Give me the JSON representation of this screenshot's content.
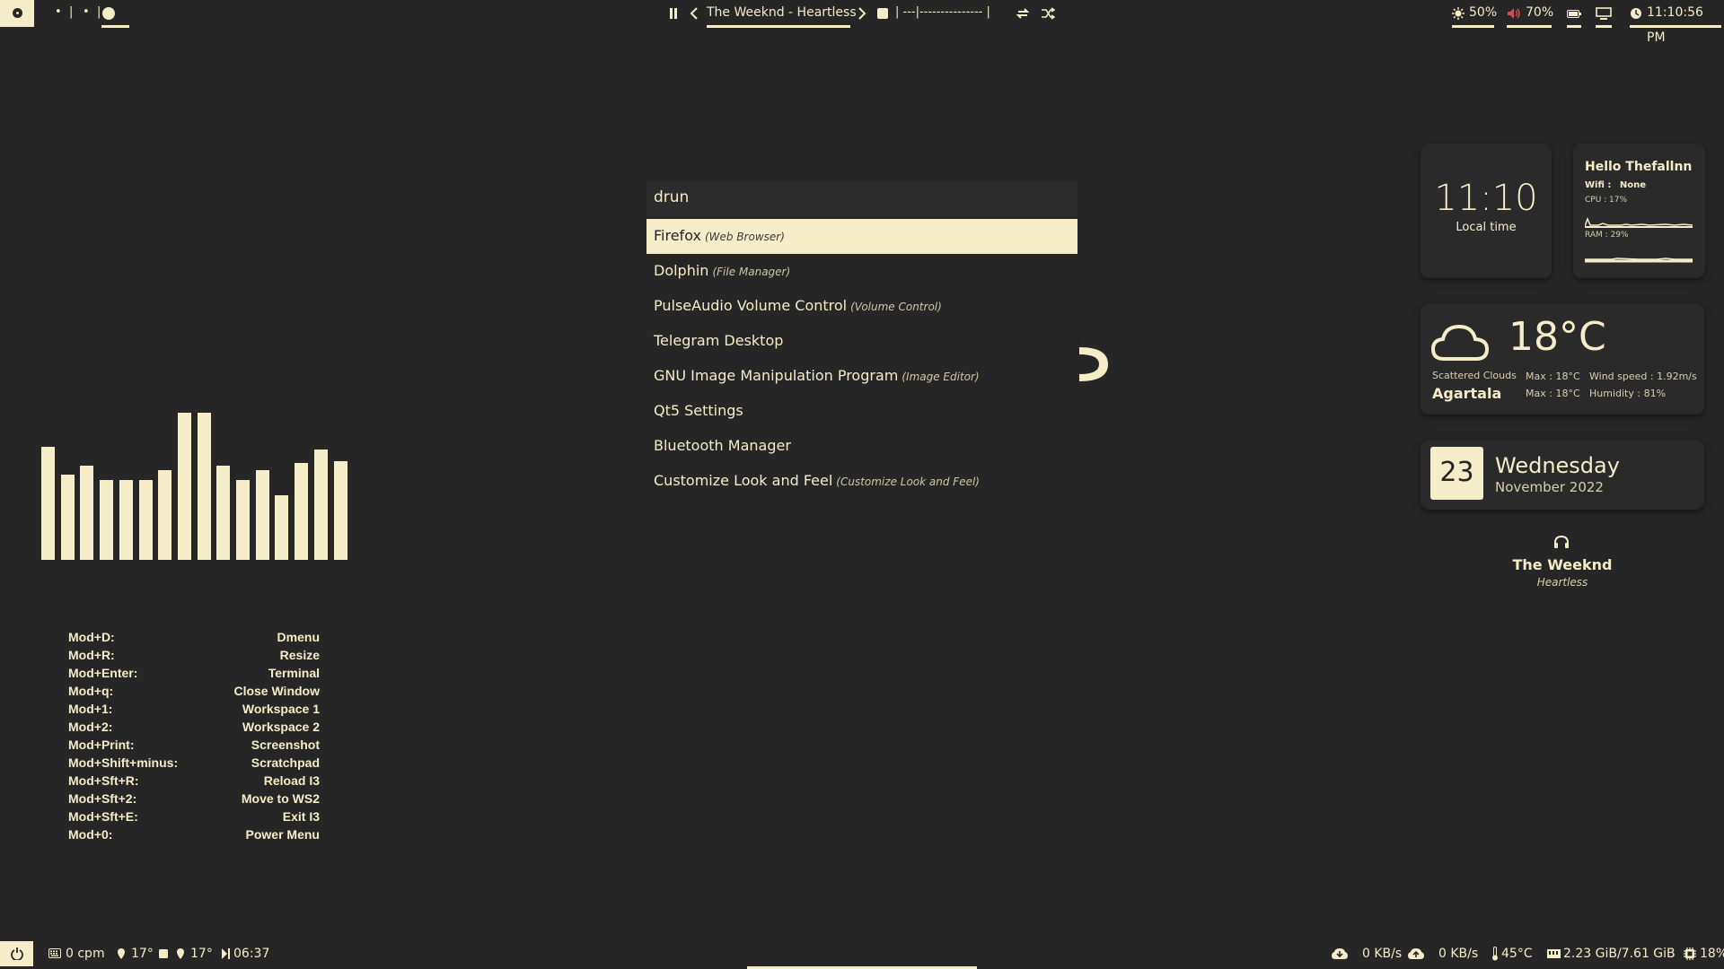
{
  "colors": {
    "background": "#262626",
    "accent": "#f5ecc8",
    "volume_icon": "#e04848"
  },
  "topbar": {
    "workspaces": [
      "•",
      "|",
      "•",
      "|"
    ],
    "media": {
      "icons": [
        "pause-icon",
        "prev-icon",
        "next-icon",
        "stop-icon",
        "repeat-icon",
        "shuffle-icon"
      ],
      "track": "The Weeknd - Heartless",
      "progress_text": "| ---|--------------- |"
    },
    "tray": {
      "brightness": "50%",
      "volume": "70%",
      "clock": "11:10:56 PM"
    }
  },
  "launcher": {
    "mode": "drun",
    "entries": [
      {
        "name": "Firefox",
        "desc": "(Web Browser)"
      },
      {
        "name": "Dolphin",
        "desc": "(File Manager)"
      },
      {
        "name": "PulseAudio Volume Control",
        "desc": "(Volume Control)"
      },
      {
        "name": "Telegram Desktop",
        "desc": ""
      },
      {
        "name": "GNU Image Manipulation Program",
        "desc": "(Image Editor)"
      },
      {
        "name": "Qt5 Settings",
        "desc": ""
      },
      {
        "name": "Bluetooth Manager",
        "desc": ""
      },
      {
        "name": "Customize Look and Feel",
        "desc": "(Customize Look and Feel)"
      }
    ],
    "selected_index": 0
  },
  "visualizer": {
    "levels": [
      0.77,
      0.58,
      0.64,
      0.54,
      0.54,
      0.54,
      0.61,
      1.0,
      1.0,
      0.64,
      0.54,
      0.61,
      0.44,
      0.66,
      0.75,
      0.67
    ]
  },
  "keybindings": [
    {
      "key": "Mod+D:",
      "action": "Dmenu"
    },
    {
      "key": "Mod+R:",
      "action": "Resize"
    },
    {
      "key": "Mod+Enter:",
      "action": "Terminal"
    },
    {
      "key": "Mod+q:",
      "action": "Close Window"
    },
    {
      "key": "Mod+1:",
      "action": "Workspace 1"
    },
    {
      "key": "Mod+2:",
      "action": "Workspace 2"
    },
    {
      "key": "Mod+Print:",
      "action": "Screenshot"
    },
    {
      "key": "Mod+Shift+minus:",
      "action": "Scratchpad"
    },
    {
      "key": "Mod+Sft+R:",
      "action": "Reload I3"
    },
    {
      "key": "Mod+Sft+2:",
      "action": "Move to WS2"
    },
    {
      "key": "Mod+Sft+E:",
      "action": "Exit I3"
    },
    {
      "key": "Mod+0:",
      "action": "Power Menu"
    }
  ],
  "widgets": {
    "clock": {
      "time": "11:10",
      "label": "Local time"
    },
    "system": {
      "greeting": "Hello Thefallnn",
      "wifi_label": "Wifi :",
      "wifi_value": "None",
      "cpu": "CPU : 17%",
      "ram": "RAM : 29%"
    },
    "weather": {
      "temp": "18°C",
      "condition": "Scattered Clouds",
      "city": "Agartala",
      "max1": "Max : 18°C",
      "max2": "Max : 18°C",
      "wind": "Wind speed : 1.92m/s",
      "humidity": "Humidity : 81%"
    },
    "date": {
      "day": "23",
      "weekday": "Wednesday",
      "month_year": "November 2022"
    },
    "music": {
      "artist": "The Weeknd",
      "title": "Heartless"
    }
  },
  "bottombar": {
    "cpm": "0 cpm",
    "temp1": "17°",
    "temp2": "17°",
    "uptime": "06:37",
    "down": "0 KB/s",
    "up": "0 KB/s",
    "cpu_temp": "45°C",
    "memory": "2.23 GiB/7.61 GiB",
    "cpu_usage": "18%"
  }
}
